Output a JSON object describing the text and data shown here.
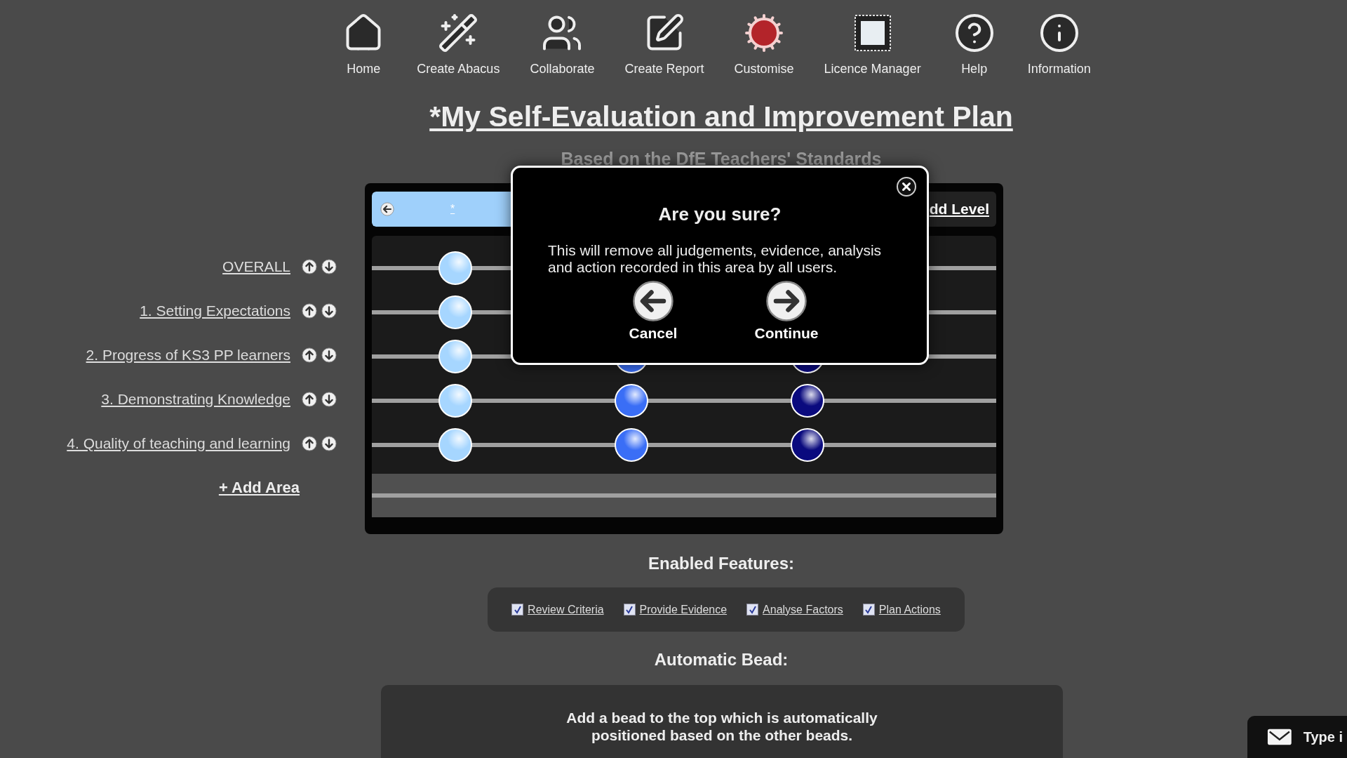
{
  "toolbar": [
    {
      "kind": "home",
      "label": "Home"
    },
    {
      "kind": "wand",
      "label": "Create Abacus"
    },
    {
      "kind": "people",
      "label": "Collaborate"
    },
    {
      "kind": "report",
      "label": "Create Report"
    },
    {
      "kind": "gears",
      "label": "Customise"
    },
    {
      "kind": "stamp",
      "label": "Licence Manager"
    },
    {
      "kind": "help",
      "label": "Help"
    },
    {
      "kind": "info",
      "label": "Information"
    }
  ],
  "title": "*My Self-Evaluation and Improvement Plan",
  "subtitle": "Based on the DfE Teachers' Standards",
  "abacus": {
    "header": {
      "level_name": "*",
      "add_level": "dd Level"
    },
    "rows": [
      {
        "label": "OVERALL",
        "beads": [
          {
            "kind": "light"
          }
        ]
      },
      {
        "label": "1. Setting Expectations",
        "beads": [
          {
            "kind": "light"
          }
        ]
      },
      {
        "label": "2. Progress of KS3 PP learners",
        "beads": [
          {
            "kind": "light"
          },
          {
            "kind": "medium"
          },
          {
            "kind": "dark"
          }
        ]
      },
      {
        "label": "3. Demonstrating Knowledge",
        "beads": [
          {
            "kind": "light"
          },
          {
            "kind": "medium"
          },
          {
            "kind": "dark"
          }
        ]
      },
      {
        "label": "4. Quality of teaching and learning",
        "beads": [
          {
            "kind": "light"
          },
          {
            "kind": "medium"
          },
          {
            "kind": "dark"
          }
        ]
      }
    ],
    "add_area": "+ Add Area"
  },
  "dialog": {
    "title": "Are you sure?",
    "message": "This will remove all judgements, evidence, analysis and action recorded in this area by all users.",
    "cancel": "Cancel",
    "continue": "Continue"
  },
  "features": {
    "heading": "Enabled Features:",
    "items": [
      {
        "label": "Review Criteria",
        "checked": true
      },
      {
        "label": "Provide Evidence",
        "checked": true
      },
      {
        "label": "Analyse Factors",
        "checked": true
      },
      {
        "label": "Plan Actions",
        "checked": true
      }
    ]
  },
  "automatic_bead": {
    "heading": "Automatic Bead:",
    "description": "Add a bead to the top which is automatically positioned based on the other beads."
  },
  "chat": {
    "label": "Type i"
  }
}
